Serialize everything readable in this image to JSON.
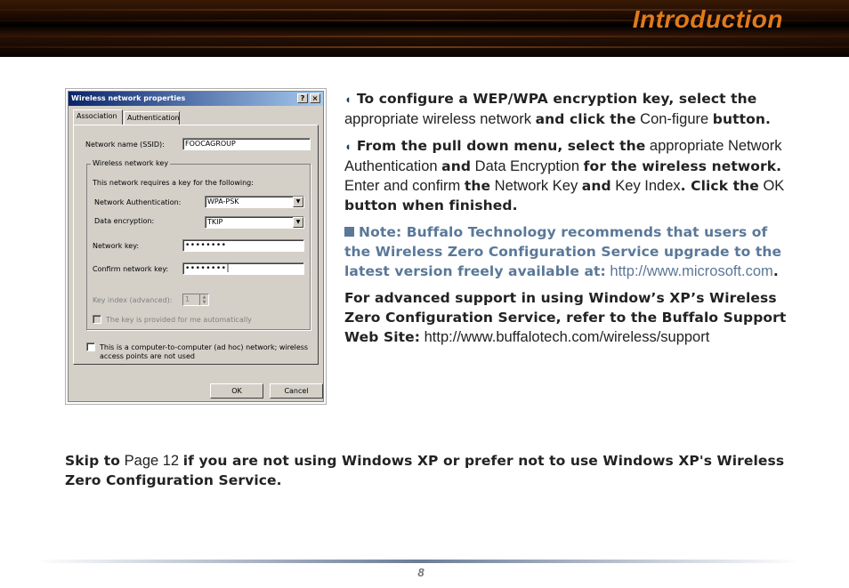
{
  "header": {
    "title": "Introduction"
  },
  "dialog": {
    "title": "Wireless network properties",
    "help_btn": "?",
    "close_btn": "×",
    "tabs": [
      "Association",
      "Authentication"
    ],
    "ssid_label": "Network name (SSID):",
    "ssid_value": "FOOCAGROUP",
    "group_title": "Wireless network key",
    "requires_text": "This network requires a key for the following:",
    "auth_label": "Network Authentication:",
    "auth_value": "WPA-PSK",
    "enc_label": "Data encryption:",
    "enc_value": "TKIP",
    "key_label": "Network key:",
    "key_value": "••••••••",
    "confirm_label": "Confirm network key:",
    "confirm_value": "••••••••|",
    "index_label": "Key index (advanced):",
    "index_value": "1",
    "auto_label": "The key is provided for me automatically",
    "adhoc_label_1": "This is a computer-to-computer (ad hoc) network; wireless",
    "adhoc_label_2": "access points are not used",
    "ok_label": "OK",
    "cancel_label": "Cancel"
  },
  "content": {
    "p1": {
      "a": "To configure a WEP/WPA encryption key, select the",
      "b": " appropriate wireless network ",
      "c": "and click the",
      "d": " Con-figure ",
      "e": "button."
    },
    "p2": {
      "a": "From the pull down menu, select the",
      "b": " appropriate Network Authentication ",
      "c": "and",
      "d": " Data Encryption ",
      "e": "for the wireless network.",
      "f": "  Enter and confirm ",
      "g": "the",
      "h": " Network Key ",
      "i": "and",
      "j": " Key Index",
      "k": ".  Click the",
      "l": " OK ",
      "m": "button when finished."
    },
    "note": {
      "a": "Note: Buffalo Technology recommends that users of the Wireless Zero Configuration Service upgrade to the latest version freely available at:",
      "url": "http://www.microsoft.com",
      "end": "."
    },
    "p4": {
      "a": "For advanced support in using Window’s XP’s Wireless Zero Configuration Service, refer to the Buffalo Support Web Site:",
      "url": " http://www.buffalotech.com/wireless/support"
    },
    "skip": {
      "a": "Skip to",
      "b": " Page 12 ",
      "c": "if you are not using Windows XP or prefer not to use Windows XP's Wireless Zero Configuration Service."
    }
  },
  "footer": {
    "page_number": "8"
  }
}
